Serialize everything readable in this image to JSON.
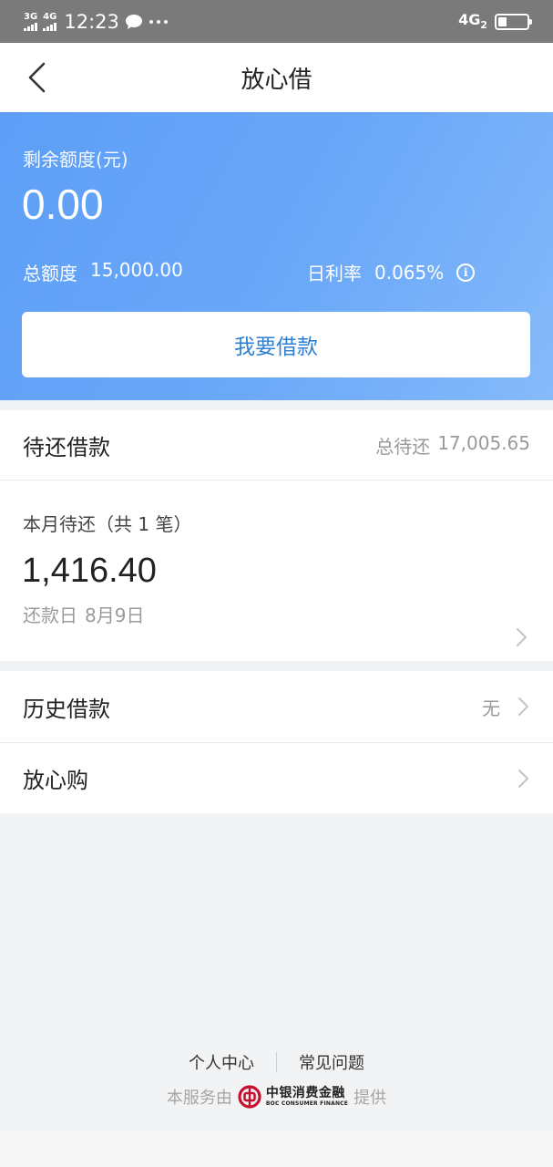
{
  "status_bar": {
    "network1": "3G",
    "network2": "4G",
    "time": "12:23",
    "right_network": "4G",
    "right_network_sub": "2",
    "battery_level": 0.3
  },
  "header": {
    "title": "放心借"
  },
  "credit": {
    "remaining_label": "剩余额度(元)",
    "remaining_amount": "0.00",
    "total_label": "总额度",
    "total_value": "15,000.00",
    "rate_label": "日利率",
    "rate_value": "0.065%",
    "borrow_button": "我要借款"
  },
  "pending": {
    "title": "待还借款",
    "total_label": "总待还",
    "total_value": "17,005.65",
    "month_label": "本月待还（共 1 笔）",
    "month_amount": "1,416.40",
    "due_label": "还款日",
    "due_date": "8月9日"
  },
  "list": {
    "history_label": "历史借款",
    "history_value": "无",
    "shop_label": "放心购"
  },
  "footer": {
    "personal_center": "个人中心",
    "faq": "常见问题",
    "provided_prefix": "本服务由",
    "provider_name": "中银消费金融",
    "provider_en": "BOC CONSUMER FINANCE",
    "provided_suffix": "提供"
  },
  "colors": {
    "accent_blue": "#5d9ef7",
    "button_text": "#2f7fd3",
    "boc_red": "#c8102e"
  }
}
